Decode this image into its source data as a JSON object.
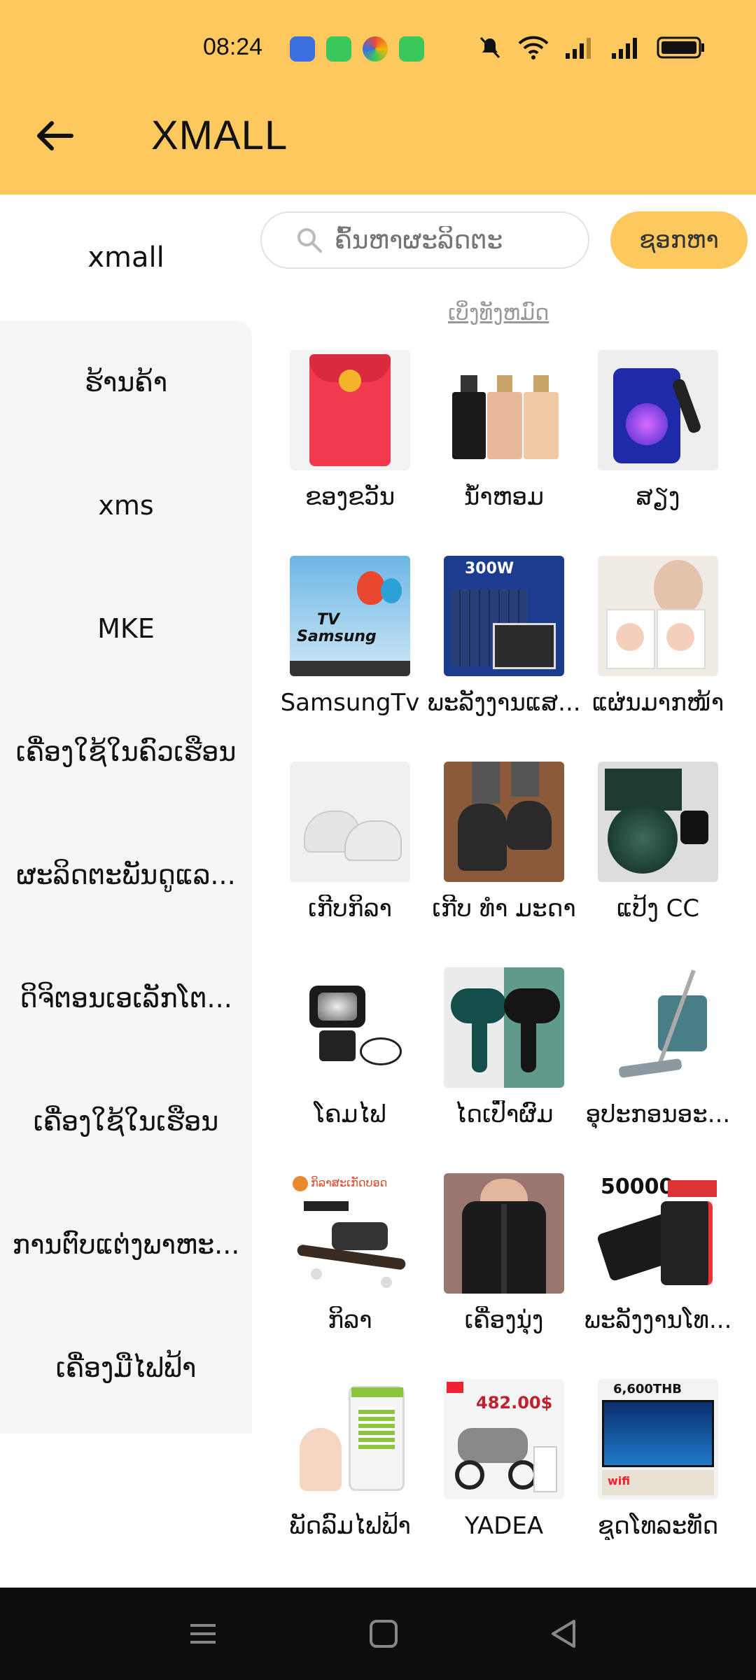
{
  "status": {
    "time": "08:24"
  },
  "header": {
    "title": "XMALL"
  },
  "sidebar": {
    "active": "xmall",
    "items": [
      "ຮ້ານຄ້າ",
      "xms",
      "MKE",
      "ເຄື່ອງໃຊ້ໃນຄົວເຮືອນ",
      "ຜະລິດຕະພັນດູແລ...",
      "ດິຈິຕອນເອເລັກໂຕ...",
      "ເຄື່ອງໃຊ້ໃນເຮືອນ",
      "ການຕົບແຕ່ງພາຫະ...",
      "ເຄື່ອງມືໄຟຟ້າ"
    ]
  },
  "search": {
    "placeholder": "ຄົ້ນຫາຜະລິດຕະ",
    "button": "ຊອກຫາ"
  },
  "view_all": "ເບິ່ງທັງຫມົດ",
  "products": [
    {
      "label": "ຂອງຂວັນ",
      "icon": "red-envelope-image"
    },
    {
      "label": "ນ້ຳຫອມ",
      "icon": "perfume-image"
    },
    {
      "label": "ສຽງ",
      "icon": "speaker-image"
    },
    {
      "label": "SamsungTv",
      "icon": "tv-image",
      "overlay": "TV Samsung"
    },
    {
      "label": "ພະລັງງານແສ...",
      "icon": "solar-light-image",
      "overlay": "300W"
    },
    {
      "label": "ແຜ່ນມາກໜ້າ",
      "icon": "face-mask-image"
    },
    {
      "label": "ເກີບກິລາ",
      "icon": "sneaker-image"
    },
    {
      "label": "ເກີບ ທຳ ມະດາ",
      "icon": "leather-shoe-image"
    },
    {
      "label": "ແປ້ງ CC",
      "icon": "cushion-compact-image"
    },
    {
      "label": "ໂຄມໄຟ",
      "icon": "searchlight-image"
    },
    {
      "label": "ໄດເປົ່າຜົມ",
      "icon": "hair-dryer-image"
    },
    {
      "label": "ອຸປະກອນອະ...",
      "icon": "mop-image"
    },
    {
      "label": "ກິລາ",
      "icon": "skateboard-image",
      "overlay": "ກິລາສະເກັດບອດ"
    },
    {
      "label": "ເຄື່ອງນຸ່ງ",
      "icon": "coat-image"
    },
    {
      "label": "ພະລັງງານໂທ...",
      "icon": "powerbank-image",
      "overlay": "50000"
    },
    {
      "label": "ພັດລົມໄຟຟ້າ",
      "icon": "air-cooler-image"
    },
    {
      "label": "YADEA",
      "icon": "e-scooter-image",
      "overlay": "482.00$"
    },
    {
      "label": "ຊຸດໂທລະທັດ",
      "icon": "haier-tv-image",
      "overlay": "6,600THB"
    }
  ],
  "colors": {
    "accent": "#FDC95E",
    "sidebar_bg": "#F6F6F7",
    "navbar": "#0E0E0E"
  }
}
